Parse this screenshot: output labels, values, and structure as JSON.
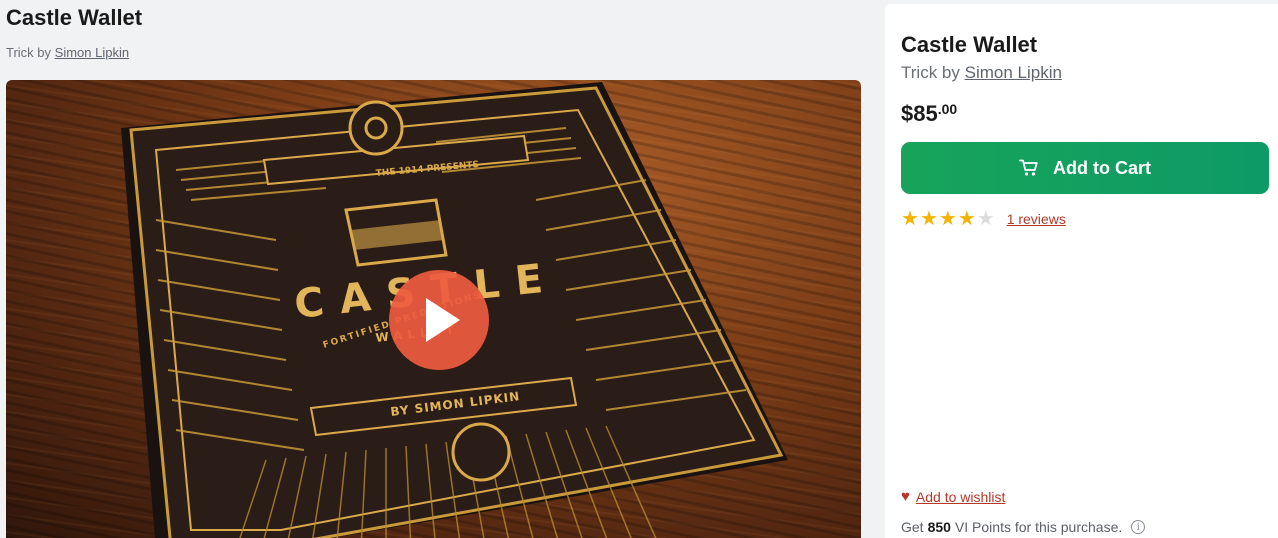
{
  "product": {
    "title": "Castle Wallet",
    "byline_prefix": "Trick by",
    "author": "Simon Lipkin"
  },
  "media": {
    "box_top_text": "THE 1914 PRESENTS",
    "box_brand_line1": "CASTLE",
    "box_brand_line2": "WALLET",
    "box_tagline": "FORTIFIED PREDICTIONS",
    "box_author": "BY SIMON LIPKIN",
    "play_icon": "play-icon"
  },
  "panel": {
    "price_dollars": "$85",
    "price_cents": ".00",
    "add_to_cart_label": "Add to Cart",
    "cart_icon": "cart-icon",
    "rating": 4,
    "rating_max": 5,
    "reviews_label": "1 reviews",
    "wishlist_label": "Add to wishlist",
    "points_prefix": "Get",
    "points_value": "850",
    "points_suffix": "VI Points for this purchase."
  },
  "colors": {
    "cart_button": "#17a45a",
    "star": "#f4b400",
    "link_red": "#b23a2a",
    "play_button": "#ee5b3f"
  }
}
